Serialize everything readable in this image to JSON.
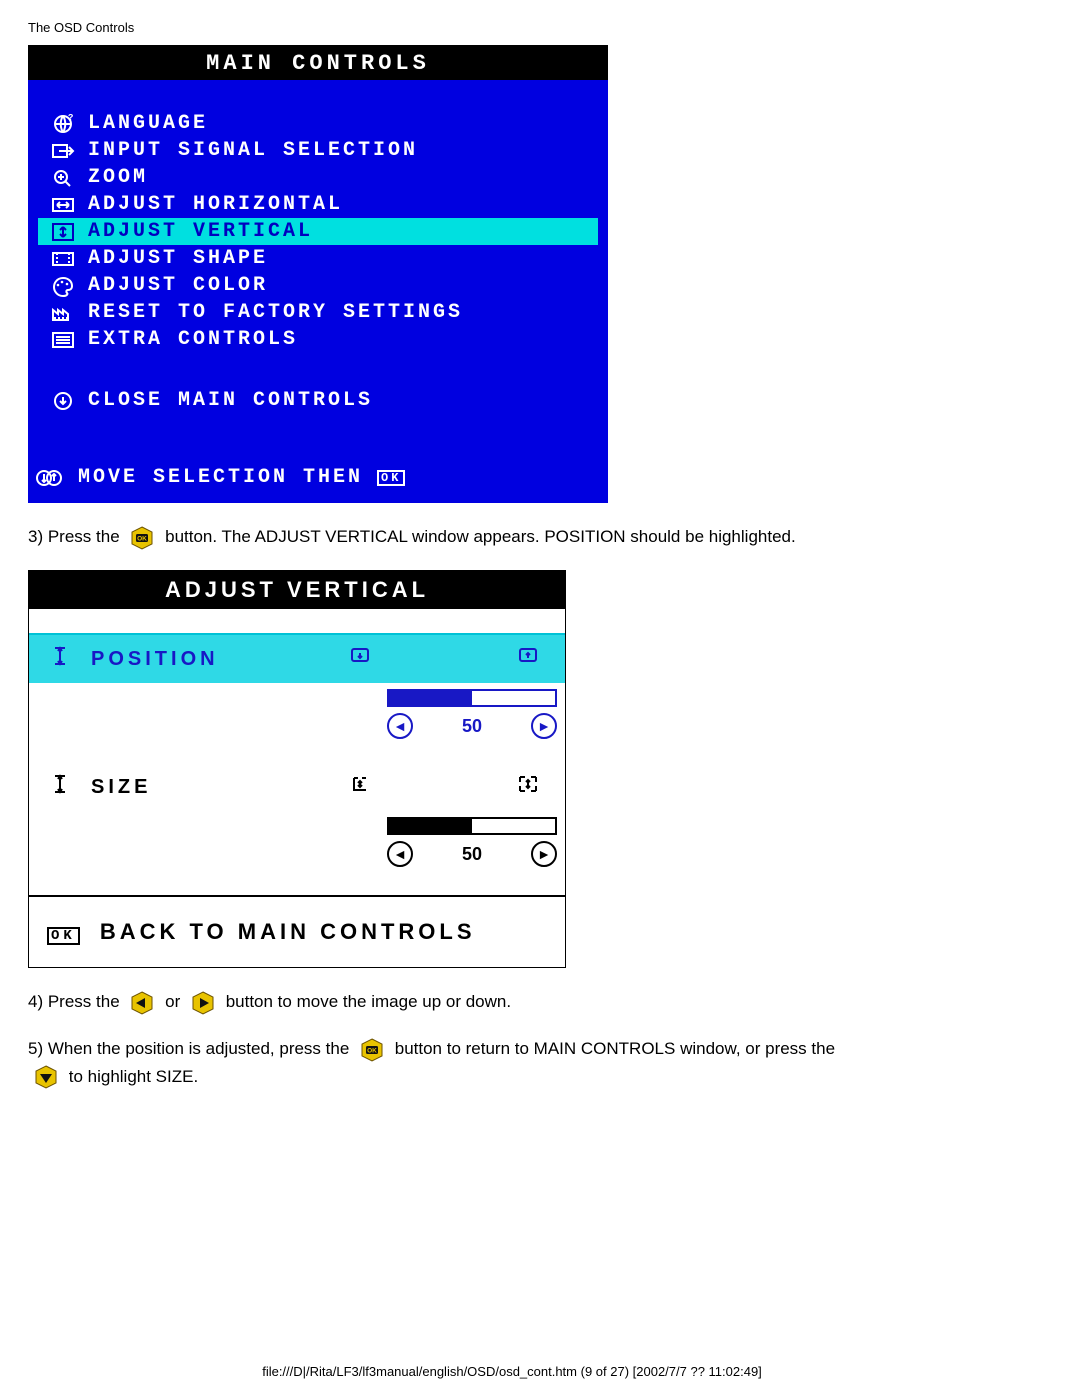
{
  "page_header": "The OSD Controls",
  "main_controls": {
    "title": "MAIN CONTROLS",
    "items": [
      {
        "icon": "globe-question-icon",
        "label": "LANGUAGE",
        "selected": false
      },
      {
        "icon": "input-arrow-icon",
        "label": "INPUT SIGNAL SELECTION",
        "selected": false
      },
      {
        "icon": "magnify-plus-icon",
        "label": "ZOOM",
        "selected": false
      },
      {
        "icon": "horiz-arrows-icon",
        "label": "ADJUST HORIZONTAL",
        "selected": false
      },
      {
        "icon": "vert-arrows-icon",
        "label": "ADJUST VERTICAL",
        "selected": true
      },
      {
        "icon": "shape-icon",
        "label": "ADJUST SHAPE",
        "selected": false
      },
      {
        "icon": "palette-icon",
        "label": "ADJUST COLOR",
        "selected": false
      },
      {
        "icon": "factory-icon",
        "label": "RESET TO FACTORY SETTINGS",
        "selected": false
      },
      {
        "icon": "list-icon",
        "label": "EXTRA CONTROLS",
        "selected": false
      }
    ],
    "close_label": "CLOSE MAIN CONTROLS",
    "footer_label": "MOVE SELECTION THEN"
  },
  "step3": {
    "prefix": "3) Press the ",
    "suffix": " button. The ADJUST VERTICAL window appears. POSITION should be highlighted."
  },
  "adjust_vertical": {
    "title": "ADJUST VERTICAL",
    "position": {
      "label": "POSITION",
      "value": "50",
      "percent": 50
    },
    "size": {
      "label": "SIZE",
      "value": "50",
      "percent": 50
    },
    "back_label": "BACK TO MAIN CONTROLS"
  },
  "step4": {
    "prefix": "4) Press the ",
    "mid": " or ",
    "suffix": " button to move the image up or down."
  },
  "step5": {
    "prefix": "5) When the position is adjusted, press the ",
    "mid": " button to return to MAIN CONTROLS window, or press the ",
    "suffix": " to highlight SIZE."
  },
  "footer_path": "file:///D|/Rita/LF3/lf3manual/english/OSD/osd_cont.htm (9 of 27) [2002/7/7 ?? 11:02:49]"
}
